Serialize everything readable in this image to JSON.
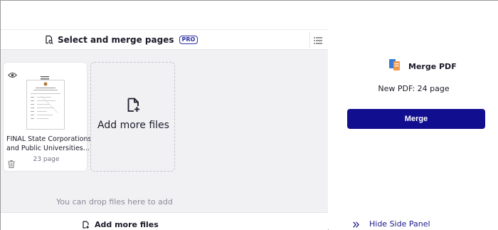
{
  "header": {
    "title": "Select and merge pages",
    "pro_badge": "PRO",
    "icons": {
      "title": "document-search-icon",
      "menu": "list-menu-icon"
    }
  },
  "files": [
    {
      "name_line1": "FINAL State Corporations",
      "name_line2": "and Public Universities...",
      "pages": "23 page"
    }
  ],
  "add_box": {
    "label": "Add more files",
    "icon": "add-file-icon"
  },
  "drop_hint": "You can drop files here to add",
  "footer": {
    "label": "Add more files",
    "icon": "add-file-icon"
  },
  "side_panel": {
    "tool_name": "Merge PDF",
    "tool_icon": "merge-pdf-icon",
    "new_pdf": "New PDF: 24 page",
    "merge_button": "Merge",
    "hide_label": "Hide Side Panel",
    "hide_icon": "double-chevron-right-icon"
  },
  "colors": {
    "accent": "#110e8f",
    "work_bg": "#f1f1f4",
    "pro": "#2d2fa3"
  }
}
